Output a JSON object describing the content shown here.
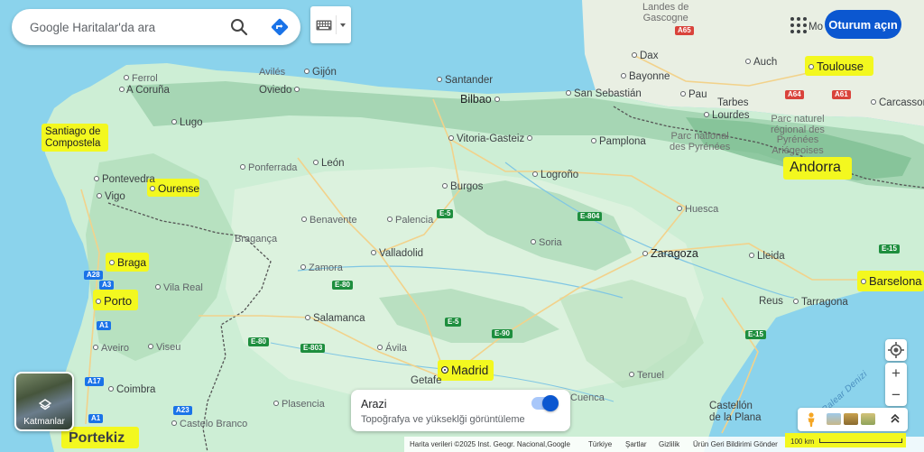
{
  "search": {
    "placeholder": "Google Haritalar'da ara"
  },
  "header": {
    "sign_in_label": "Oturum açın"
  },
  "layers": {
    "label": "Katmanlar"
  },
  "terrain": {
    "title": "Arazi",
    "subtitle": "Topoğrafya ve yükseklği görüntüleme",
    "enabled": true
  },
  "footer": {
    "attribution": "Harita verileri ©2025 Inst. Geogr. Nacional,Google",
    "links": [
      "Türkiye",
      "Şartlar",
      "Gizlilik",
      "Ürün Geri Bildirimi Gönder"
    ],
    "scale": "100 km"
  },
  "icons": {
    "search": "search-icon",
    "directions": "directions-icon",
    "keyboard": "keyboard-icon",
    "apps": "apps-grid-icon",
    "layers": "layers-icon",
    "my_location": "my-location-icon",
    "zoom_in": "zoom-in-icon",
    "zoom_out": "zoom-out-icon",
    "pegman": "pegman-icon",
    "expand": "chevron-up-icon"
  },
  "colors": {
    "highlight": "#f3f81f",
    "accent": "#0b57d0",
    "sea": "#8bd3ec",
    "land": "#c9ead2"
  },
  "highlighted_places": {
    "toulouse": "Toulouse",
    "santiago": "Santiago de\nCompostela",
    "ourense": "Ourense",
    "andorra": "Andorra",
    "braga": "Braga",
    "porto": "Porto",
    "barselona": "Barselona",
    "madrid": "Madrid",
    "portekiz": "Portekiz"
  },
  "places": {
    "gascogne": "Landes de\nGascogne",
    "bordeaux_top": "Mo",
    "avilesX": "Avilés",
    "gijon": "Gijón",
    "oviedo": "Oviedo",
    "ferrol": "Ferrol",
    "acoruna": "A Coruña",
    "lugo": "Lugo",
    "santander": "Santander",
    "bilbao": "Bilbao",
    "sansebastian": "San Sebastián",
    "bayonne": "Bayonne",
    "dax": "Dax",
    "auch": "Auch",
    "pau": "Pau",
    "tarbes": "Tarbes",
    "lourdes": "Lourdes",
    "carcassonne": "Carcassonne",
    "vitoria": "Vitoria-Gasteiz",
    "pamplona": "Pamplona",
    "leon": "León",
    "ponferrada": "Ponferrada",
    "pontevedra": "Pontevedra",
    "vigo": "Vigo",
    "burgos": "Burgos",
    "logrono": "Logroño",
    "huesca": "Huesca",
    "benavente": "Benavente",
    "palencia": "Palencia",
    "braganca": "Bragança",
    "soria": "Soria",
    "zaragoza": "Zaragoza",
    "valladolid": "Valladolid",
    "zamora": "Zamora",
    "lleida": "Lleida",
    "vilareal": "Vila Real",
    "salamanca": "Salamanca",
    "reus": "Reus",
    "tarragona": "Tarragona",
    "aveiro": "Aveiro",
    "viseu": "Viseu",
    "avila": "Ávila",
    "getafe": "Getafe",
    "coimbra": "Coimbra",
    "teruel": "Teruel",
    "plasencia": "Plasencia",
    "castelo": "Castelo Branco",
    "castellon": "Castellón\nde la Plana",
    "cuenca": "Cuenca",
    "pyrenees_fr": "Parc national\ndes Pyrénées",
    "pyrenees_ar": "Parc naturel\nrégional des\nPyrénées\nAriégeoises",
    "balear": "Balear Denizi"
  },
  "roads": [
    "A65",
    "A64",
    "A61",
    "E-5",
    "E-804",
    "E-80",
    "E-803",
    "E-90",
    "E-15",
    "A28",
    "A3",
    "A1",
    "A17",
    "A23"
  ]
}
